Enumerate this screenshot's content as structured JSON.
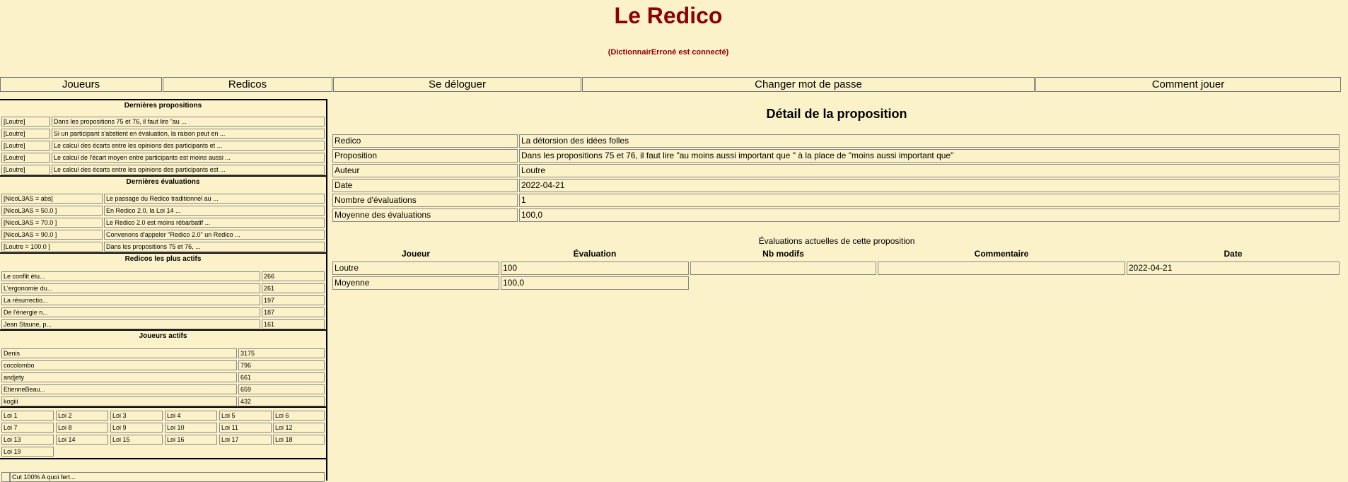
{
  "site_title": "Le Redico",
  "connected": "(DictionnairErroné est connecté)",
  "nav": [
    "Joueurs",
    "Redicos",
    "Se déloguer",
    "Changer mot de passe",
    "Comment jouer"
  ],
  "sidebar": {
    "last_props": {
      "title": "Dernières propositions",
      "rows": [
        {
          "author": "[Loutre]",
          "text": "Dans les propositions 75 et 76, il faut lire \"au ..."
        },
        {
          "author": "[Loutre]",
          "text": "Si un participant s'abstient en évaluation, la raison peut en ..."
        },
        {
          "author": "[Loutre]",
          "text": "Le calcul des écarts entre les opinions des participants et ..."
        },
        {
          "author": "[Loutre]",
          "text": "Le calcul de l'écart moyen entre participants est moins aussi ..."
        },
        {
          "author": "[Loutre]",
          "text": "Le calcul des écarts entre les opinions des participants est ..."
        }
      ]
    },
    "last_evals": {
      "title": "Dernières évaluations",
      "rows": [
        {
          "who": "[NicoL3AS = abs]",
          "text": "Le passage du Redico traditionnel au ..."
        },
        {
          "who": "[NicoL3AS = 50.0 ]",
          "text": "En Redico 2.0, la Loi 14 ..."
        },
        {
          "who": "[NicoL3AS = 70.0 ]",
          "text": "Le Redico 2.0 est moins rébarbatif ..."
        },
        {
          "who": "[NicoL3AS = 90.0 ]",
          "text": "Convenons d'appeler \"Redico 2.0\" un Redico ..."
        },
        {
          "who": "[Loutre = 100.0 ]",
          "text": "Dans les propositions 75 et 76, ..."
        }
      ]
    },
    "active_redicos": {
      "title": "Redicos les plus actifs",
      "rows": [
        {
          "name": "Le conflit étu...",
          "count": "266"
        },
        {
          "name": "L'ergonomie du...",
          "count": "261"
        },
        {
          "name": "La résurrectio...",
          "count": "197"
        },
        {
          "name": "De l'énergie n...",
          "count": "187"
        },
        {
          "name": "Jean Staune, p...",
          "count": "161"
        }
      ]
    },
    "active_players": {
      "title": "Joueurs actifs",
      "rows": [
        {
          "name": "Denis",
          "count": "3175"
        },
        {
          "name": "cocolombo",
          "count": "796"
        },
        {
          "name": "andjety",
          "count": "661"
        },
        {
          "name": "EtienneBeau...",
          "count": "659"
        },
        {
          "name": "kogiii",
          "count": "432"
        }
      ]
    },
    "laws": [
      "Loi 1",
      "Loi 2",
      "Loi 3",
      "Loi 4",
      "Loi 5",
      "Loi 6",
      "Loi 7",
      "Loi 8",
      "Loi 9",
      "Loi 10",
      "Loi 11",
      "Loi 12",
      "Loi 13",
      "Loi 14",
      "Loi 15",
      "Loi 16",
      "Loi 17",
      "Loi 18",
      "Loi 19"
    ],
    "bottom_text": "Cut 100% A quoi fert..."
  },
  "detail": {
    "title": "Détail de la proposition",
    "rows": [
      {
        "label": "Redico",
        "value": "La détorsion des idées folles"
      },
      {
        "label": "Proposition",
        "value": "Dans les propositions 75 et 76, il faut lire \"au moins aussi important que \" à la place de \"moins aussi important que\""
      },
      {
        "label": "Auteur",
        "value": "Loutre"
      },
      {
        "label": "Date",
        "value": "2022-04-21"
      },
      {
        "label": "Nombre d'évaluations",
        "value": "1"
      },
      {
        "label": "Moyenne des évaluations",
        "value": "100,0"
      }
    ]
  },
  "evaluations": {
    "title": "Évaluations actuelles de cette proposition",
    "headers": [
      "Joueur",
      "Évaluation",
      "Nb modifs",
      "Commentaire",
      "Date"
    ],
    "rows": [
      {
        "player": "Loutre",
        "evaluation": "100",
        "nb_modifs": "",
        "comment": "",
        "date": "2022-04-21"
      }
    ],
    "average_label": "Moyenne",
    "average_value": "100,0"
  }
}
